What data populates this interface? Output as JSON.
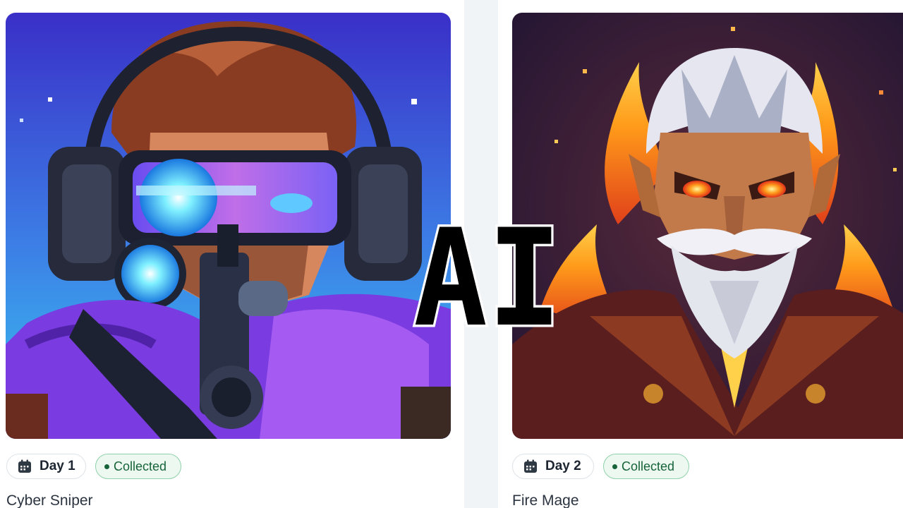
{
  "cards": [
    {
      "image_icon": "cyber-sniper-portrait",
      "day_label": "Day 1",
      "status_label": "Collected",
      "title": "Cyber Sniper"
    },
    {
      "image_icon": "fire-mage-portrait",
      "day_label": "Day 2",
      "status_label": "Collected",
      "title": "Fire Mage"
    }
  ],
  "overlay": {
    "text": "AI"
  },
  "colors": {
    "page_background": "#f1f4f7",
    "card_background": "#ffffff",
    "collected_border": "#8fd1a9",
    "collected_background": "#ecf8f0",
    "collected_text": "#17643a"
  }
}
